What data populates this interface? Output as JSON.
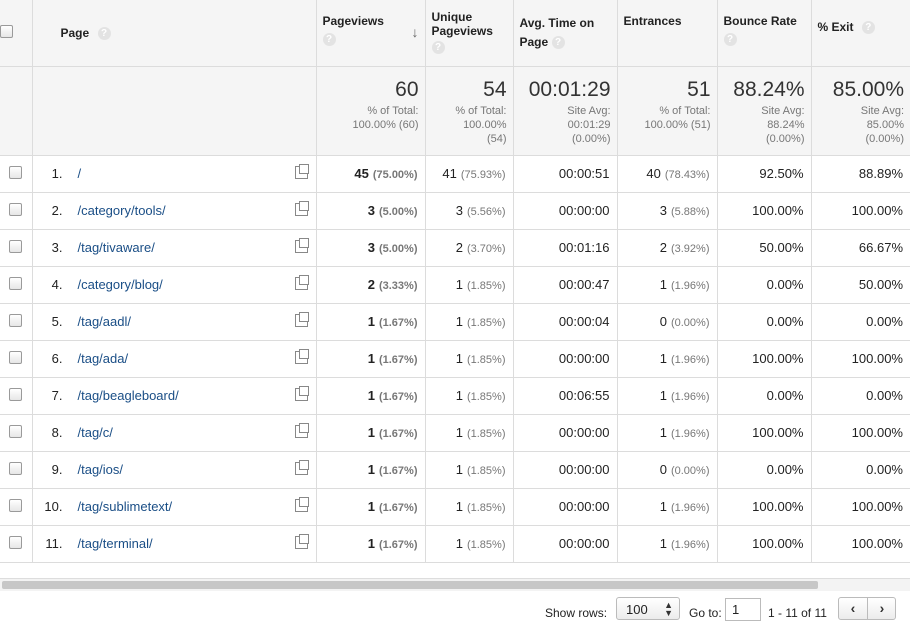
{
  "columns": {
    "page": "Page",
    "pageviews": "Pageviews",
    "unique_pageviews": "Unique Pageviews",
    "avg_time": "Avg. Time on Page",
    "entrances": "Entrances",
    "bounce_rate": "Bounce Rate",
    "exit": "% Exit"
  },
  "help_glyph": "?",
  "sort_glyph": "↓",
  "summary": {
    "pageviews": {
      "value": "60",
      "line1": "% of Total:",
      "line2": "100.00% (60)",
      "line3": ""
    },
    "unique_pageviews": {
      "value": "54",
      "line1": "% of Total:",
      "line2": "100.00%",
      "line3": "(54)"
    },
    "avg_time": {
      "value": "00:01:29",
      "line1": "Site Avg:",
      "line2": "00:01:29",
      "line3": "(0.00%)"
    },
    "entrances": {
      "value": "51",
      "line1": "% of Total:",
      "line2": "100.00% (51)",
      "line3": ""
    },
    "bounce_rate": {
      "value": "88.24%",
      "line1": "Site Avg:",
      "line2": "88.24%",
      "line3": "(0.00%)"
    },
    "exit": {
      "value": "85.00%",
      "line1": "Site Avg:",
      "line2": "85.00%",
      "line3": "(0.00%)"
    }
  },
  "rows": [
    {
      "rank": "1.",
      "page": "/",
      "pv": "45",
      "pv_pct": "(75.00%)",
      "upv": "41",
      "upv_pct": "(75.93%)",
      "time": "00:00:51",
      "ent": "40",
      "ent_pct": "(78.43%)",
      "bounce": "92.50%",
      "exit": "88.89%"
    },
    {
      "rank": "2.",
      "page": "/category/tools/",
      "pv": "3",
      "pv_pct": "(5.00%)",
      "upv": "3",
      "upv_pct": "(5.56%)",
      "time": "00:00:00",
      "ent": "3",
      "ent_pct": "(5.88%)",
      "bounce": "100.00%",
      "exit": "100.00%"
    },
    {
      "rank": "3.",
      "page": "/tag/tivaware/",
      "pv": "3",
      "pv_pct": "(5.00%)",
      "upv": "2",
      "upv_pct": "(3.70%)",
      "time": "00:01:16",
      "ent": "2",
      "ent_pct": "(3.92%)",
      "bounce": "50.00%",
      "exit": "66.67%"
    },
    {
      "rank": "4.",
      "page": "/category/blog/",
      "pv": "2",
      "pv_pct": "(3.33%)",
      "upv": "1",
      "upv_pct": "(1.85%)",
      "time": "00:00:47",
      "ent": "1",
      "ent_pct": "(1.96%)",
      "bounce": "0.00%",
      "exit": "50.00%"
    },
    {
      "rank": "5.",
      "page": "/tag/aadl/",
      "pv": "1",
      "pv_pct": "(1.67%)",
      "upv": "1",
      "upv_pct": "(1.85%)",
      "time": "00:00:04",
      "ent": "0",
      "ent_pct": "(0.00%)",
      "bounce": "0.00%",
      "exit": "0.00%"
    },
    {
      "rank": "6.",
      "page": "/tag/ada/",
      "pv": "1",
      "pv_pct": "(1.67%)",
      "upv": "1",
      "upv_pct": "(1.85%)",
      "time": "00:00:00",
      "ent": "1",
      "ent_pct": "(1.96%)",
      "bounce": "100.00%",
      "exit": "100.00%"
    },
    {
      "rank": "7.",
      "page": "/tag/beagleboard/",
      "pv": "1",
      "pv_pct": "(1.67%)",
      "upv": "1",
      "upv_pct": "(1.85%)",
      "time": "00:06:55",
      "ent": "1",
      "ent_pct": "(1.96%)",
      "bounce": "0.00%",
      "exit": "0.00%"
    },
    {
      "rank": "8.",
      "page": "/tag/c/",
      "pv": "1",
      "pv_pct": "(1.67%)",
      "upv": "1",
      "upv_pct": "(1.85%)",
      "time": "00:00:00",
      "ent": "1",
      "ent_pct": "(1.96%)",
      "bounce": "100.00%",
      "exit": "100.00%"
    },
    {
      "rank": "9.",
      "page": "/tag/ios/",
      "pv": "1",
      "pv_pct": "(1.67%)",
      "upv": "1",
      "upv_pct": "(1.85%)",
      "time": "00:00:00",
      "ent": "0",
      "ent_pct": "(0.00%)",
      "bounce": "0.00%",
      "exit": "0.00%"
    },
    {
      "rank": "10.",
      "page": "/tag/sublimetext/",
      "pv": "1",
      "pv_pct": "(1.67%)",
      "upv": "1",
      "upv_pct": "(1.85%)",
      "time": "00:00:00",
      "ent": "1",
      "ent_pct": "(1.96%)",
      "bounce": "100.00%",
      "exit": "100.00%"
    },
    {
      "rank": "11.",
      "page": "/tag/terminal/",
      "pv": "1",
      "pv_pct": "(1.67%)",
      "upv": "1",
      "upv_pct": "(1.85%)",
      "time": "00:00:00",
      "ent": "1",
      "ent_pct": "(1.96%)",
      "bounce": "100.00%",
      "exit": "100.00%"
    }
  ],
  "footer": {
    "show_rows_label": "Show rows:",
    "show_rows_value": "100",
    "goto_label": "Go to:",
    "goto_value": "1",
    "range": "1 - 11 of 11",
    "prev_glyph": "‹",
    "next_glyph": "›"
  },
  "colors": {
    "link": "#1a4e86",
    "header_bg": "#f5f5f5",
    "muted": "#777777"
  }
}
